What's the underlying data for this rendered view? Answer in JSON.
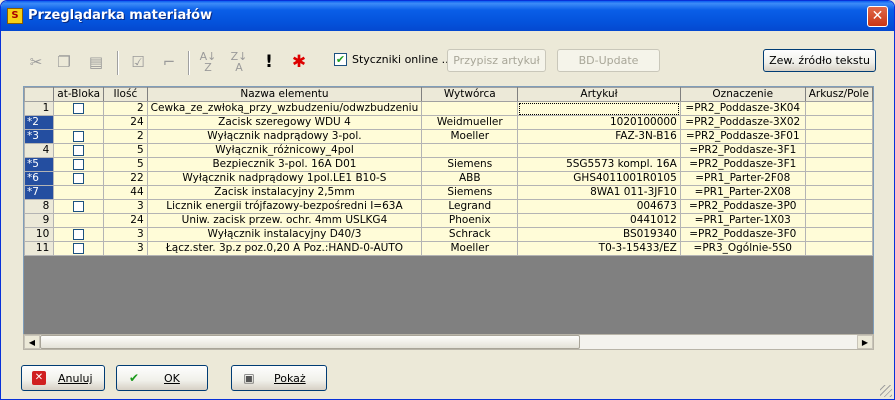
{
  "window": {
    "title": "Przeglądarka materiałów",
    "icon": "app-icon",
    "close_glyph": "✕"
  },
  "toolbar": {
    "icons": [
      "scissors-icon",
      "copy-icon",
      "paste-icon",
      "check-icon",
      "uncheck-icon",
      "sort-az-icon",
      "sort-za-icon",
      "exclamation-icon",
      "asterisk-icon"
    ],
    "styczniki_checkbox": {
      "label": "Styczniki online ...",
      "checked": true
    },
    "przypisz_label": "Przypisz artykuł",
    "bd_update_label": "BD-Update",
    "zew_label": "Zew. źródło tekstu"
  },
  "grid": {
    "columns": [
      "",
      "at-Bloka",
      "Ilość",
      "Nazwa elementu",
      "Wytwórca",
      "Artykuł",
      "Oznaczenie",
      "Arkusz/Pole"
    ],
    "rows": [
      {
        "id": "1",
        "selected": false,
        "check": true,
        "qty": "2",
        "name": "Cewka_ze_zwłoką_przy_wzbudzeniu/odwzbudzeniu",
        "maker": "",
        "article": "",
        "designation": "=PR2_Poddasze-3K04",
        "sheet": ""
      },
      {
        "id": "*2",
        "selected": true,
        "check": false,
        "qty": "24",
        "name": "Zacisk szeregowy WDU 4",
        "maker": "Weidmueller",
        "article": "1020100000",
        "designation": "=PR2_Poddasze-3X02",
        "sheet": ""
      },
      {
        "id": "*3",
        "selected": true,
        "check": true,
        "qty": "2",
        "name": "Wyłącznik nadprądowy 3-pol.",
        "maker": "Moeller",
        "article": "FAZ-3N-B16",
        "designation": "=PR2_Poddasze-3F01",
        "sheet": ""
      },
      {
        "id": "4",
        "selected": false,
        "check": true,
        "qty": "5",
        "name": "Wyłącznik_różnicowy_4pol",
        "maker": "",
        "article": "",
        "designation": "=PR2_Poddasze-3F1",
        "sheet": ""
      },
      {
        "id": "*5",
        "selected": true,
        "check": true,
        "qty": "5",
        "name": "Bezpiecznik 3-pol. 16A D01",
        "maker": "Siemens",
        "article": "5SG5573 kompl. 16A",
        "designation": "=PR2_Poddasze-3F1",
        "sheet": ""
      },
      {
        "id": "*6",
        "selected": true,
        "check": true,
        "qty": "22",
        "name": "Wyłącznik nadprądowy 1pol.LE1 B10-S",
        "maker": "ABB",
        "article": "GHS4011001R0105",
        "designation": "=PR1_Parter-2F08",
        "sheet": ""
      },
      {
        "id": "*7",
        "selected": true,
        "check": false,
        "qty": "44",
        "name": "Zacisk instalacyjny 2,5mm",
        "maker": "Siemens",
        "article": "8WA1 011-3JF10",
        "designation": "=PR1_Parter-2X08",
        "sheet": ""
      },
      {
        "id": "8",
        "selected": false,
        "check": true,
        "qty": "3",
        "name": "Licznik energii trójfazowy-bezpośredni I=63A",
        "maker": "Legrand",
        "article": "004673",
        "designation": "=PR2_Poddasze-3P0",
        "sheet": ""
      },
      {
        "id": "9",
        "selected": false,
        "check": false,
        "qty": "24",
        "name": "Uniw. zacisk przew. ochr. 4mm USLKG4",
        "maker": "Phoenix",
        "article": "0441012",
        "designation": "=PR1_Parter-1X03",
        "sheet": ""
      },
      {
        "id": "10",
        "selected": false,
        "check": true,
        "qty": "3",
        "name": "Wyłącznik instalacyjny D40/3",
        "maker": "Schrack",
        "article": "BS019340",
        "designation": "=PR2_Poddasze-3F0",
        "sheet": ""
      },
      {
        "id": "11",
        "selected": false,
        "check": true,
        "qty": "3",
        "name": "Łącz.ster. 3p.z poz.0,20 A Poz.:HAND-0-AUTO",
        "maker": "Moeller",
        "article": "T0-3-15433/EZ",
        "designation": "=PR3_Ogólnie-5S0",
        "sheet": ""
      }
    ]
  },
  "footer": {
    "anuluj_label": "Anuluj",
    "ok_label": "OK",
    "pokaz_label": "Pokaż"
  },
  "colors": {
    "titlebar": "#0a5fe8",
    "cell_bg": "#fffcd8",
    "selected_row_header": "#244ea0"
  }
}
